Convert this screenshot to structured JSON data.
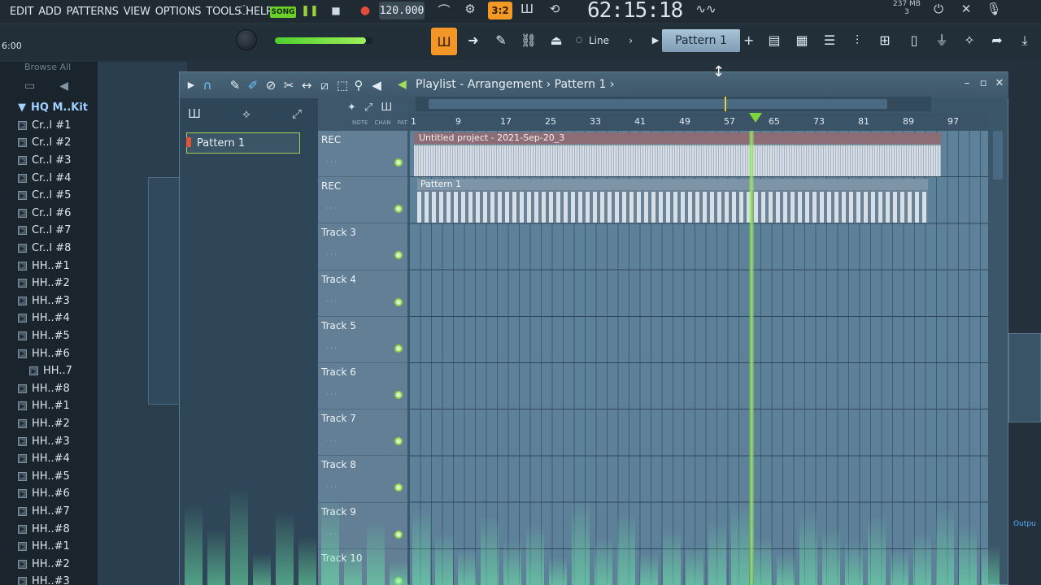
{
  "menu": [
    "EDIT",
    "ADD",
    "PATTERNS",
    "VIEW",
    "OPTIONS",
    "TOOLS",
    "HELP"
  ],
  "transport": {
    "mode_label": "SONG",
    "tempo": "120.000",
    "time": "62:15:18",
    "snap_label": "3:2",
    "cpu_line1": "237 MB",
    "cpu_line2": "3"
  },
  "toolbar2": {
    "hint": "6:00",
    "line_label": "Line",
    "pattern_label": "Pattern 1",
    "master_volume_fraction": 0.93
  },
  "browser": {
    "title": "Browse  All",
    "folder": "HQ M..Kit",
    "items": [
      "Cr..l #1",
      "Cr..l #2",
      "Cr..l #3",
      "Cr..l #4",
      "Cr..l #5",
      "Cr..l #6",
      "Cr..l #7",
      "Cr..l #8",
      "HH..#1",
      "HH..#2",
      "HH..#3",
      "HH..#4",
      "HH..#5",
      "HH..#6",
      "HH..7",
      "HH..#8",
      "HH..#1",
      "HH..#2",
      "HH..#3",
      "HH..#4",
      "HH..#5",
      "HH..#6",
      "HH..#7",
      "HH..#8",
      "HH..#1",
      "HH..#2",
      "HH..#3"
    ],
    "subitem_index": 14
  },
  "playlist": {
    "title": "Playlist - Arrangement",
    "pattern": "Pattern 1",
    "picker_pattern": "Pattern 1",
    "header_labels": [
      "NOTE",
      "CHAN",
      "PAT"
    ],
    "ruler": [
      "1",
      "9",
      "17",
      "25",
      "33",
      "41",
      "49",
      "57",
      "65",
      "73",
      "81",
      "89",
      "97"
    ],
    "tracks": [
      "REC",
      "REC",
      "Track 3",
      "Track 4",
      "Track 5",
      "Track 6",
      "Track 7",
      "Track 8",
      "Track 9",
      "Track 10"
    ],
    "audio_clip_label": "Untitled project - 2021-Sep-20_3",
    "pattern_clip_label": "Pattern 1"
  },
  "right": {
    "output_label": "Outpu"
  }
}
